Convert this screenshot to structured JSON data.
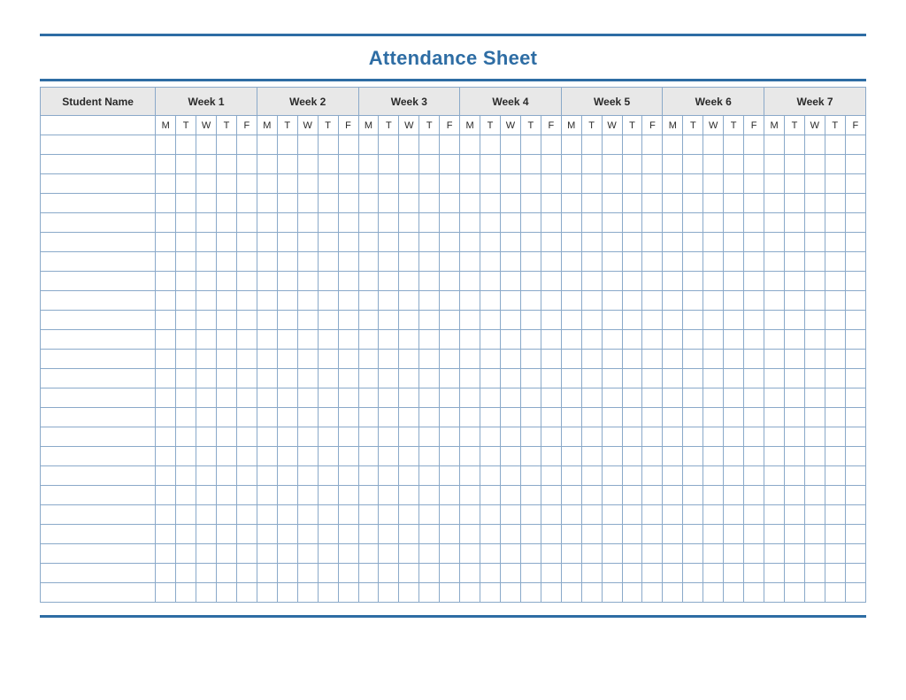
{
  "title": "Attendance Sheet",
  "columns": {
    "name_header": "Student Name",
    "weeks": [
      "Week 1",
      "Week 2",
      "Week 3",
      "Week 4",
      "Week 5",
      "Week 6",
      "Week 7"
    ],
    "days": [
      "M",
      "T",
      "W",
      "T",
      "F"
    ]
  },
  "row_count": 24
}
